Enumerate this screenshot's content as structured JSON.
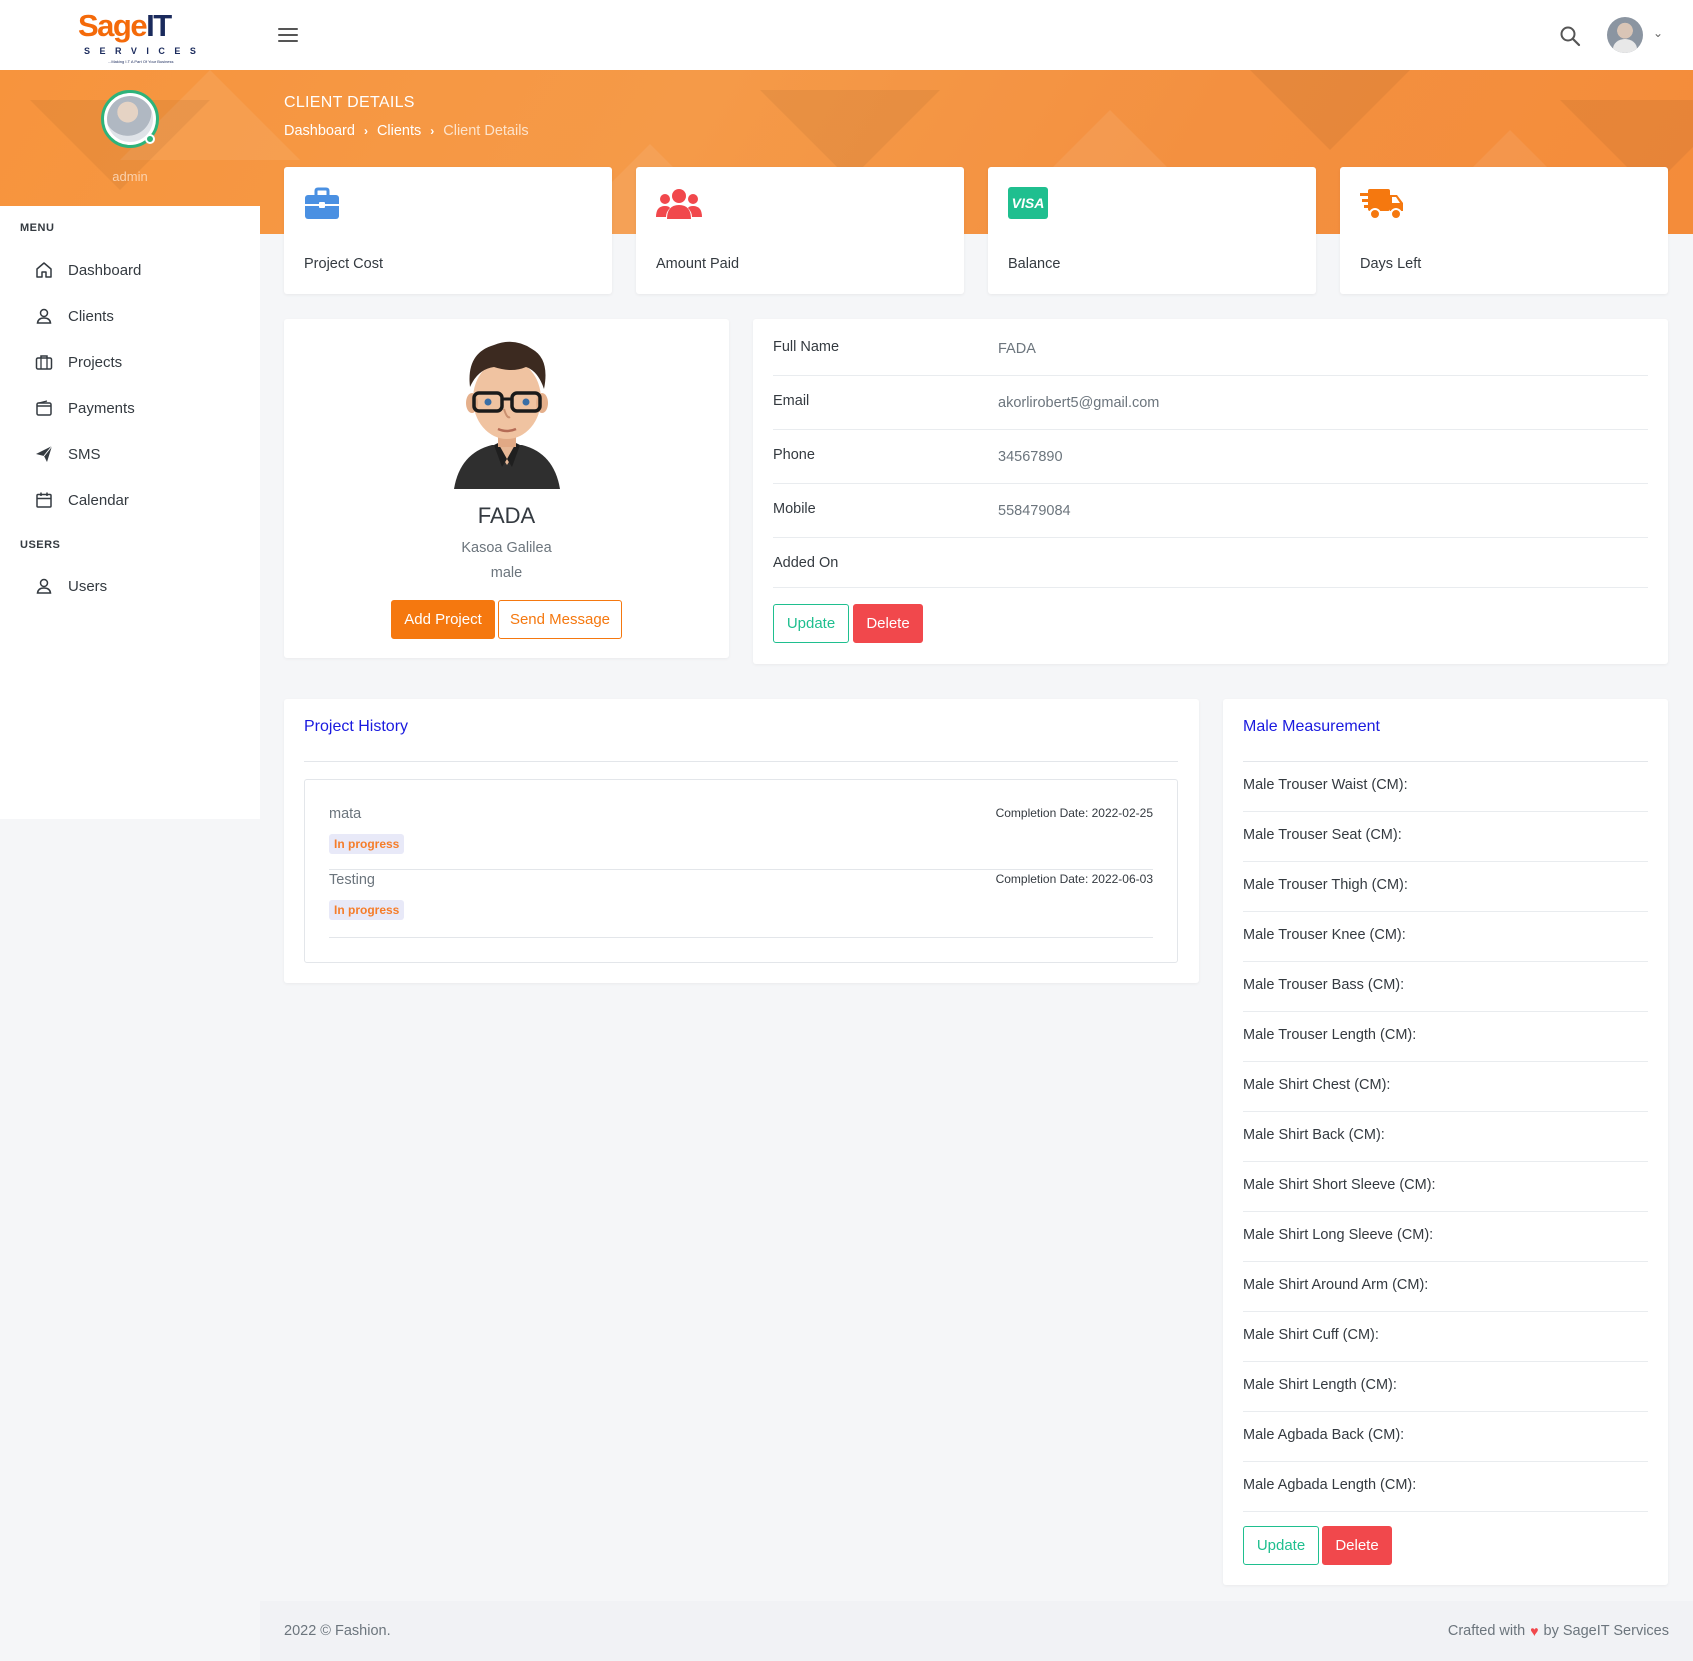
{
  "brand": {
    "logo_main": "Sage",
    "logo_it": "IT",
    "logo_sub": "SERVICES",
    "logo_tagline": "...Making I.T A Part Of Your Business",
    "accent": "#f5780f",
    "hero_color": "#f7943d"
  },
  "header": {
    "page_title": "CLIENT DETAILS",
    "breadcrumb": [
      "Dashboard",
      "Clients",
      "Client Details"
    ]
  },
  "sidebar": {
    "username": "admin",
    "menu_title": "MENU",
    "items": [
      {
        "label": "Dashboard",
        "icon": "home-icon"
      },
      {
        "label": "Clients",
        "icon": "user-icon"
      },
      {
        "label": "Projects",
        "icon": "briefcase-icon"
      },
      {
        "label": "Payments",
        "icon": "wallet-icon"
      },
      {
        "label": "SMS",
        "icon": "paper-plane-icon"
      },
      {
        "label": "Calendar",
        "icon": "calendar-icon"
      }
    ],
    "users_title": "USERS",
    "users_items": [
      {
        "label": "Users",
        "icon": "user-icon"
      }
    ]
  },
  "stats": [
    {
      "label": "Project Cost",
      "icon": "briefcase-icon",
      "color": "#4a90e2"
    },
    {
      "label": "Amount Paid",
      "icon": "users-icon",
      "color": "#f1484c"
    },
    {
      "label": "Balance",
      "icon": "visa-card-icon",
      "color": "#1fbf8f"
    },
    {
      "label": "Days Left",
      "icon": "shipping-truck-icon",
      "color": "#f5780f"
    }
  ],
  "profile": {
    "name": "FADA",
    "location": "Kasoa Galilea",
    "gender": "male",
    "add_project": "Add Project",
    "send_message": "Send Message"
  },
  "details": {
    "rows": [
      {
        "key": "Full Name",
        "value": "FADA"
      },
      {
        "key": "Email",
        "value": "akorlirobert5@gmail.com"
      },
      {
        "key": "Phone",
        "value": "34567890"
      },
      {
        "key": "Mobile",
        "value": "558479084"
      },
      {
        "key": "Added On",
        "value": ""
      }
    ],
    "update": "Update",
    "delete": "Delete"
  },
  "project_history": {
    "title": "Project History",
    "items": [
      {
        "name": "mata",
        "date": "Completion Date: 2022-02-25",
        "status": "In progress"
      },
      {
        "name": "Testing",
        "date": "Completion Date: 2022-06-03",
        "status": "In progress"
      }
    ]
  },
  "measurement": {
    "title": "Male Measurement",
    "rows": [
      "Male Trouser Waist (CM):",
      "Male Trouser Seat (CM):",
      "Male Trouser Thigh (CM):",
      "Male Trouser Knee (CM):",
      "Male Trouser Bass (CM):",
      "Male Trouser Length (CM):",
      "Male Shirt Chest (CM):",
      "Male Shirt Back (CM):",
      "Male Shirt Short Sleeve (CM):",
      "Male Shirt Long Sleeve (CM):",
      "Male Shirt Around Arm (CM):",
      "Male Shirt Cuff (CM):",
      "Male Shirt Length (CM):",
      "Male Agbada Back (CM):",
      "Male Agbada Length (CM):"
    ],
    "update": "Update",
    "delete": "Delete"
  },
  "footer": {
    "left": "2022 © Fashion.",
    "right_prefix": "Crafted with",
    "right_suffix": "by SageIT Services"
  }
}
